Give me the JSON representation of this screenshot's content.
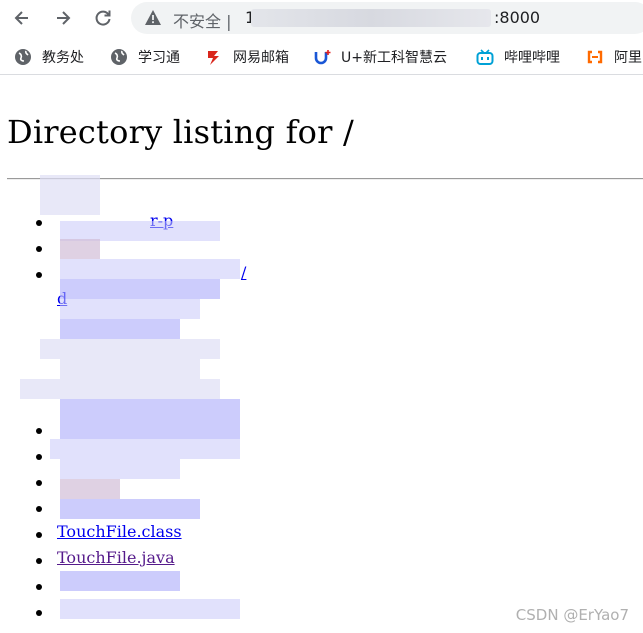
{
  "browser": {
    "security_label": "不安全 |",
    "url_visible_prefix": "1",
    "url_port": ":8000",
    "bookmarks": [
      {
        "label": "教务处",
        "icon": "globe-icon"
      },
      {
        "label": "学习通",
        "icon": "globe-icon"
      },
      {
        "label": "网易邮箱",
        "icon": "netease-mail-icon"
      },
      {
        "label": "U+新工科智慧云",
        "icon": "u-plus-icon"
      },
      {
        "label": "哔哩哔哩",
        "icon": "bilibili-icon"
      },
      {
        "label": "阿里",
        "icon": "aliyun-icon"
      }
    ]
  },
  "page": {
    "heading": "Directory listing for /",
    "files": [
      {
        "label": "TouchFile.class",
        "visited": false
      },
      {
        "label": "TouchFile.java",
        "visited": true
      }
    ],
    "partial_fragments": {
      "first_item_tail": "r-p",
      "third_item_tail": "/",
      "third_item_wrap": "d"
    }
  },
  "watermark": "CSDN @ErYao7",
  "colors": {
    "link": "#0000ee",
    "visited": "#551a8b",
    "redaction": "#aaaafa"
  }
}
